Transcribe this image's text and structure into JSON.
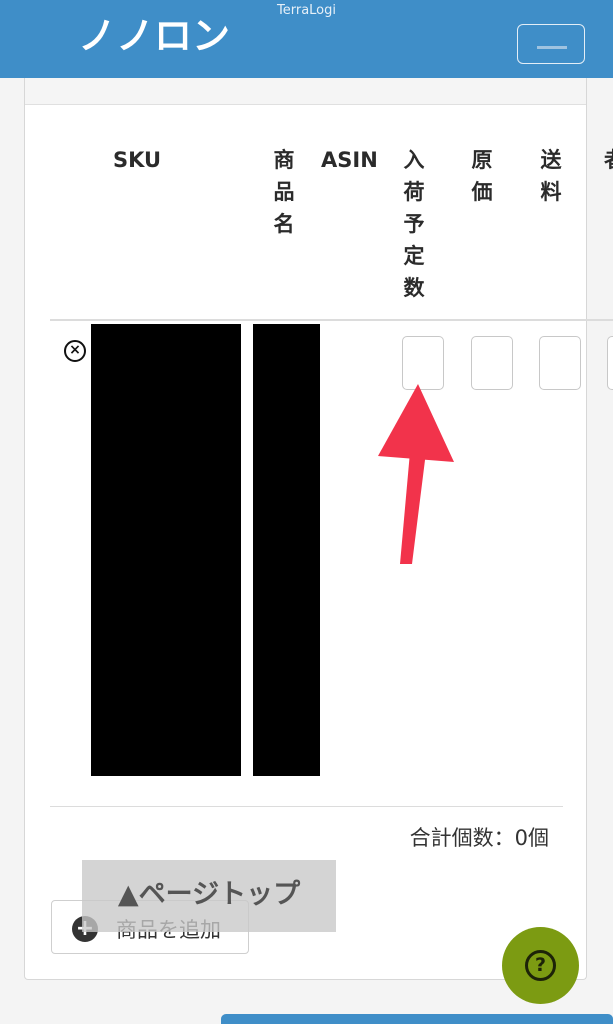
{
  "header": {
    "site_title": "TerraLogi",
    "brand_text": "ノノロン",
    "accent_color": "#3f8ec8"
  },
  "table": {
    "headers": {
      "sku": "SKU",
      "product_name": "商\n品\n名",
      "asin": "ASIN",
      "expected_qty": "入\n荷\n予\n定\n数",
      "cost": "原\n価",
      "shipping": "送\n料",
      "partial": "者"
    }
  },
  "total": {
    "label": "合計個数：0個"
  },
  "buttons": {
    "add_product": "商品を追加",
    "page_top": "▲ページトップ",
    "help": "?"
  },
  "icons": {
    "remove": "remove-icon",
    "add": "plus-circle-icon",
    "help": "question-icon",
    "menu": "hamburger-icon"
  },
  "annotation_color": "#f2334b"
}
